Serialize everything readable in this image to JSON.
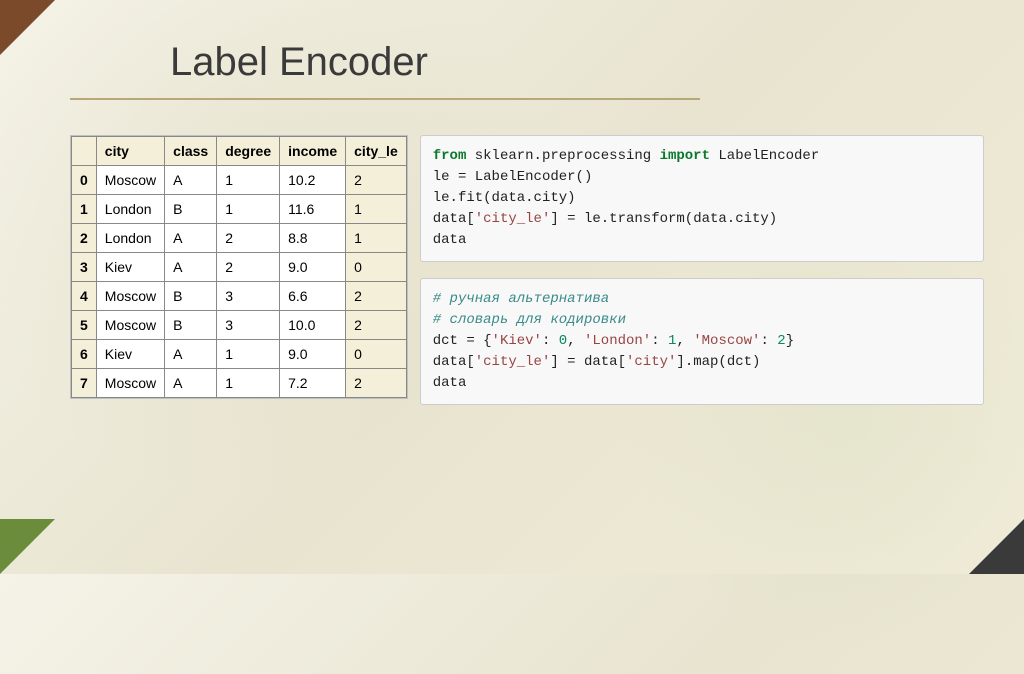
{
  "slide": {
    "title": "Label Encoder"
  },
  "table": {
    "headers": [
      "",
      "city",
      "class",
      "degree",
      "income",
      "city_le"
    ],
    "rows": [
      {
        "idx": "0",
        "city": "Moscow",
        "class": "A",
        "degree": "1",
        "income": "10.2",
        "city_le": "2"
      },
      {
        "idx": "1",
        "city": "London",
        "class": "B",
        "degree": "1",
        "income": "11.6",
        "city_le": "1"
      },
      {
        "idx": "2",
        "city": "London",
        "class": "A",
        "degree": "2",
        "income": "8.8",
        "city_le": "1"
      },
      {
        "idx": "3",
        "city": "Kiev",
        "class": "A",
        "degree": "2",
        "income": "9.0",
        "city_le": "0"
      },
      {
        "idx": "4",
        "city": "Moscow",
        "class": "B",
        "degree": "3",
        "income": "6.6",
        "city_le": "2"
      },
      {
        "idx": "5",
        "city": "Moscow",
        "class": "B",
        "degree": "3",
        "income": "10.0",
        "city_le": "2"
      },
      {
        "idx": "6",
        "city": "Kiev",
        "class": "A",
        "degree": "1",
        "income": "9.0",
        "city_le": "0"
      },
      {
        "idx": "7",
        "city": "Moscow",
        "class": "A",
        "degree": "1",
        "income": "7.2",
        "city_le": "2"
      }
    ]
  },
  "code1": {
    "l1_from": "from",
    "l1_mod": " sklearn.preprocessing ",
    "l1_import": "import",
    "l1_cls": " LabelEncoder",
    "l2": "le = LabelEncoder()",
    "l3": "le.fit(data.city)",
    "l4a": "data[",
    "l4s": "'city_le'",
    "l4b": "] = le.transform(data.city)",
    "l5": "data"
  },
  "code2": {
    "c1": "# ручная альтернатива",
    "c2": "# словарь для кодировки",
    "l3a": "dct = {",
    "l3k1": "'Kiev'",
    "l3v1": "0",
    "l3k2": "'London'",
    "l3v2": "1",
    "l3k3": "'Moscow'",
    "l3v3": "2",
    "l3z": "}",
    "l4a": "data[",
    "l4s1": "'city_le'",
    "l4b": "] = data[",
    "l4s2": "'city'",
    "l4c": "].map(dct)",
    "l5": "data"
  }
}
